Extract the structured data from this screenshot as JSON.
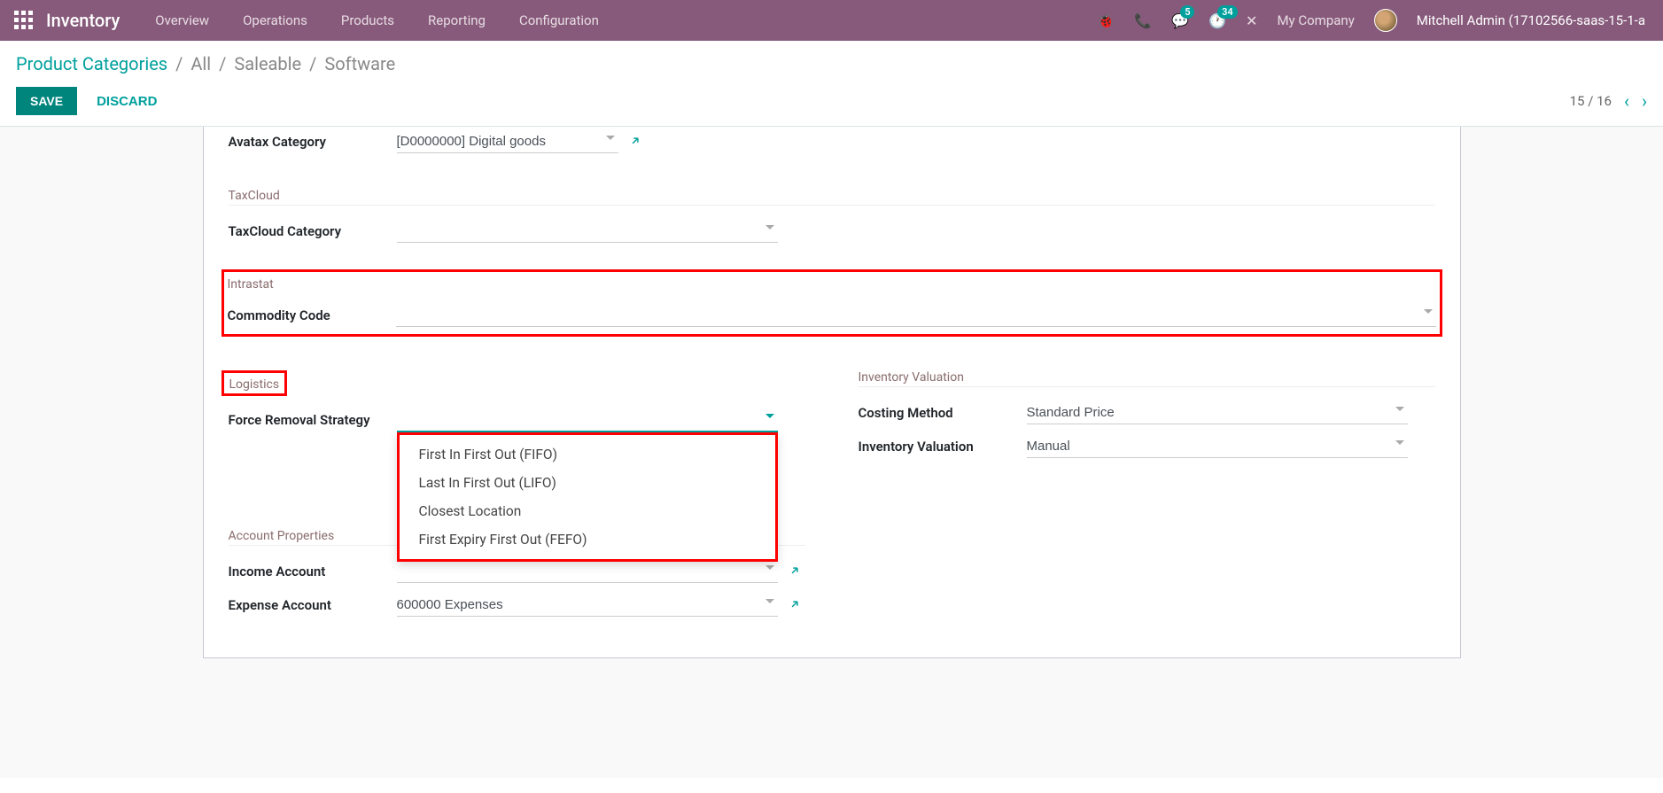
{
  "header": {
    "app_name": "Inventory",
    "menu": [
      "Overview",
      "Operations",
      "Products",
      "Reporting",
      "Configuration"
    ],
    "messages_badge": "5",
    "activities_badge": "34",
    "company": "My Company",
    "user": "Mitchell Admin (17102566-saas-15-1-a"
  },
  "breadcrumbs": {
    "root": "Product Categories",
    "path": [
      "All",
      "Saleable",
      "Software"
    ]
  },
  "buttons": {
    "save": "SAVE",
    "discard": "DISCARD"
  },
  "pager": {
    "position": "15 / 16"
  },
  "form": {
    "avatax": {
      "label": "Avatax Category",
      "value": "[D0000000] Digital goods"
    },
    "taxcloud": {
      "section": "TaxCloud",
      "label": "TaxCloud Category",
      "value": ""
    },
    "intrastat": {
      "section": "Intrastat",
      "label": "Commodity Code",
      "value": ""
    },
    "logistics": {
      "section": "Logistics",
      "removal_label": "Force Removal Strategy",
      "removal_value": "",
      "options": [
        "First In First Out (FIFO)",
        "Last In First Out (LIFO)",
        "Closest Location",
        "First Expiry First Out (FEFO)"
      ]
    },
    "valuation": {
      "section": "Inventory Valuation",
      "costing_label": "Costing Method",
      "costing_value": "Standard Price",
      "inv_label": "Inventory Valuation",
      "inv_value": "Manual"
    },
    "accounts": {
      "section": "Account Properties",
      "income_label": "Income Account",
      "income_value": "",
      "expense_label": "Expense Account",
      "expense_value": "600000 Expenses"
    }
  }
}
